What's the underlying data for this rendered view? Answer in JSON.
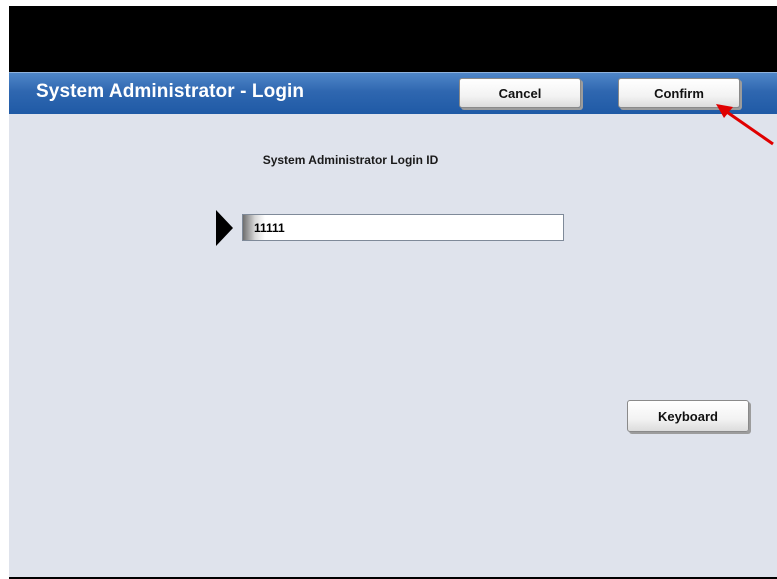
{
  "header": {
    "title": "System Administrator - Login",
    "cancel_label": "Cancel",
    "confirm_label": "Confirm"
  },
  "login": {
    "label": "System Administrator Login ID",
    "value": "11111"
  },
  "keyboard_label": "Keyboard",
  "colors": {
    "titlebar": "#2f67b0",
    "background": "#dfe3ec",
    "annotation_arrow": "#e00000"
  },
  "icons": {
    "field_pointer": "black-right-triangle",
    "annotation": "red-arrow"
  }
}
